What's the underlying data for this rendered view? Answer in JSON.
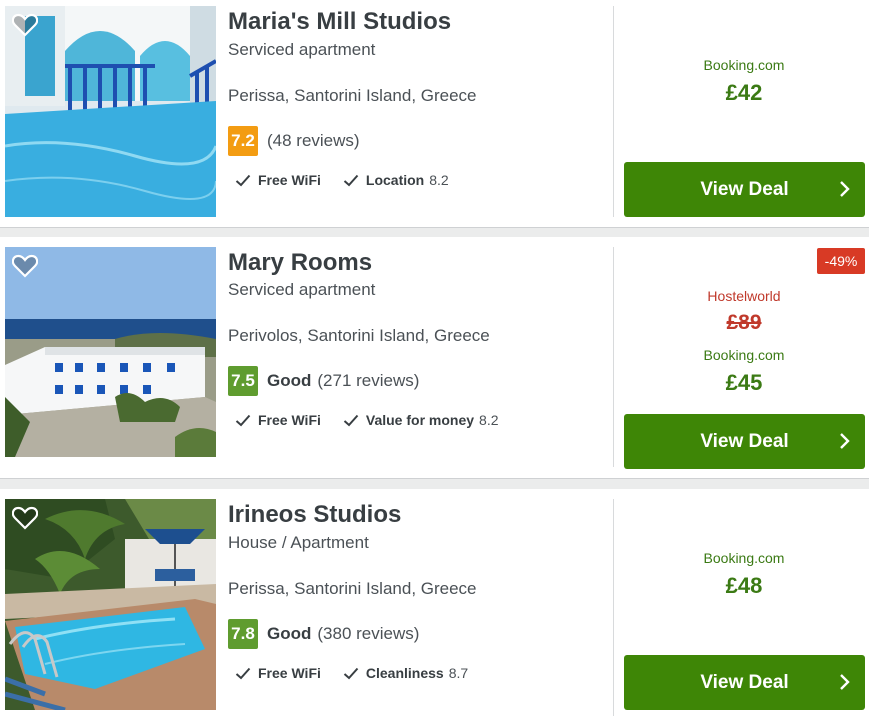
{
  "listings": [
    {
      "name": "Maria's Mill Studios",
      "type": "Serviced apartment",
      "location": "Perissa, Santorini Island, Greece",
      "score": "7.2",
      "score_color": "#f39c12",
      "rating_word": "",
      "reviews": "(48 reviews)",
      "amenities": [
        {
          "label": "Free WiFi",
          "value": ""
        },
        {
          "label": "Location",
          "value": "8.2"
        }
      ],
      "deal": {
        "provider": "Booking.com",
        "price": "£42"
      },
      "button_label": "View Deal",
      "favorite_icon": "heart-icon"
    },
    {
      "name": "Mary Rooms",
      "type": "Serviced apartment",
      "location": "Perivolos, Santorini Island, Greece",
      "score": "7.5",
      "score_color": "#5f9c2f",
      "rating_word": "Good",
      "reviews": "(271 reviews)",
      "amenities": [
        {
          "label": "Free WiFi",
          "value": ""
        },
        {
          "label": "Value for money",
          "value": "8.2"
        }
      ],
      "discount_badge": "-49%",
      "old_deal": {
        "provider": "Hostelworld",
        "price": "£89"
      },
      "deal": {
        "provider": "Booking.com",
        "price": "£45"
      },
      "button_label": "View Deal",
      "favorite_icon": "heart-icon"
    },
    {
      "name": "Irineos Studios",
      "type": "House / Apartment",
      "location": "Perissa, Santorini Island, Greece",
      "score": "7.8",
      "score_color": "#5f9c2f",
      "rating_word": "Good",
      "reviews": "(380 reviews)",
      "amenities": [
        {
          "label": "Free WiFi",
          "value": ""
        },
        {
          "label": "Cleanliness",
          "value": "8.7"
        }
      ],
      "deal": {
        "provider": "Booking.com",
        "price": "£48"
      },
      "button_label": "View Deal",
      "favorite_icon": "heart-icon"
    }
  ]
}
